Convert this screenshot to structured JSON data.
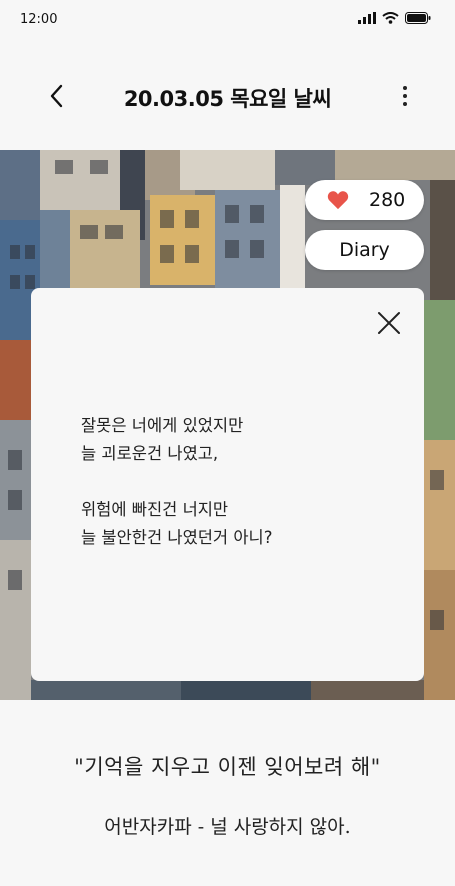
{
  "status": {
    "time": "12:00"
  },
  "nav": {
    "title": "20.03.05 목요일 날씨"
  },
  "likes": {
    "count": "280"
  },
  "diary": {
    "label": "Diary"
  },
  "modal": {
    "lines": [
      "잘못은 너에게 있었지만",
      "늘 괴로운건 나였고,",
      "위험에 빠진건 너지만",
      "늘 불안한건 나였던거 아니?"
    ]
  },
  "quote": "\"기억을 지우고 이젠 잊어보려 해\"",
  "song": "어반자카파 - 널 사랑하지 않아."
}
